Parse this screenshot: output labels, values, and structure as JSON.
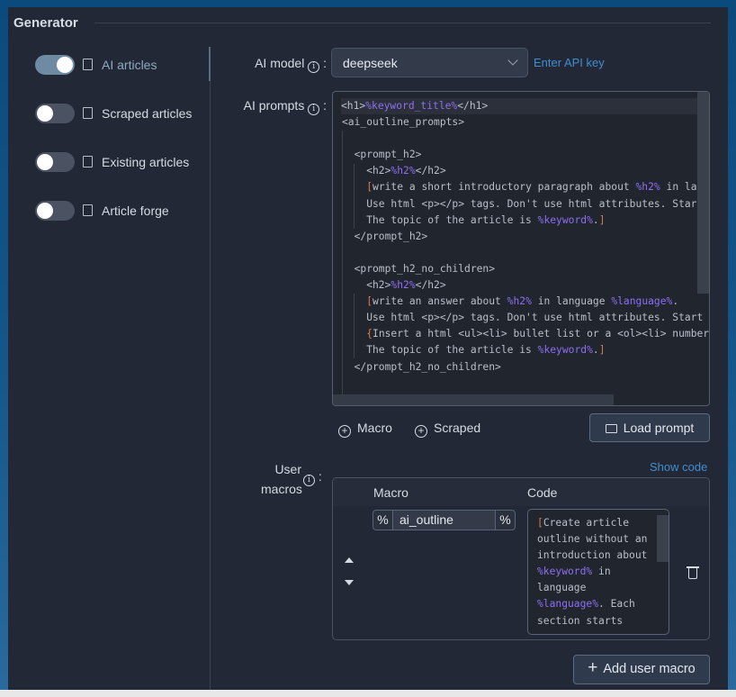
{
  "section_title": "Generator",
  "toggles": [
    {
      "label": "AI articles",
      "on": true,
      "icon": "robot-icon"
    },
    {
      "label": "Scraped articles",
      "on": false,
      "icon": "copy-icon"
    },
    {
      "label": "Existing articles",
      "on": false,
      "icon": "document-icon"
    },
    {
      "label": "Article forge",
      "on": false,
      "icon": "document-icon"
    }
  ],
  "ai_model": {
    "label": "AI model",
    "colon": ":",
    "value": "deepseek",
    "api_link": "Enter API key"
  },
  "ai_prompts": {
    "label": "AI prompts",
    "colon": ":",
    "lines": [
      [
        [
          "t",
          "<h1>"
        ],
        [
          "v",
          "%keyword_title%"
        ],
        [
          "t",
          "</h1>"
        ]
      ],
      [
        [
          "t",
          "<ai_outline_prompts>"
        ]
      ],
      [],
      [
        [
          "t",
          "  <prompt_h2>"
        ]
      ],
      [
        [
          "t",
          "    <h2>"
        ],
        [
          "v",
          "%h2%"
        ],
        [
          "t",
          "</h2>"
        ]
      ],
      [
        [
          "t",
          "    "
        ],
        [
          "b",
          "["
        ],
        [
          "t",
          "write a short introductory paragraph about "
        ],
        [
          "v",
          "%h2%"
        ],
        [
          "t",
          " in langu"
        ]
      ],
      [
        [
          "t",
          "    Use html <p></p> tags. Don't use html attributes. Start w"
        ]
      ],
      [
        [
          "t",
          "    The topic of the article is "
        ],
        [
          "v",
          "%keyword%"
        ],
        [
          "t",
          "."
        ],
        [
          "b",
          "]"
        ]
      ],
      [
        [
          "t",
          "  </prompt_h2>"
        ]
      ],
      [],
      [
        [
          "t",
          "  <prompt_h2_no_children>"
        ]
      ],
      [
        [
          "t",
          "    <h2>"
        ],
        [
          "v",
          "%h2%"
        ],
        [
          "t",
          "</h2>"
        ]
      ],
      [
        [
          "t",
          "    "
        ],
        [
          "b",
          "["
        ],
        [
          "t",
          "write an answer about "
        ],
        [
          "v",
          "%h2%"
        ],
        [
          "t",
          " in language "
        ],
        [
          "v",
          "%language%"
        ],
        [
          "t",
          "."
        ]
      ],
      [
        [
          "t",
          "    Use html <p></p> tags. Don't use html attributes. Start w"
        ]
      ],
      [
        [
          "t",
          "    "
        ],
        [
          "b",
          "{"
        ],
        [
          "t",
          "Insert a html <ul><li> bullet list or a <ol><li> numbere"
        ]
      ],
      [
        [
          "t",
          "    The topic of the article is "
        ],
        [
          "v",
          "%keyword%"
        ],
        [
          "t",
          "."
        ],
        [
          "b",
          "]"
        ]
      ],
      [
        [
          "t",
          "  </prompt_h2_no_children>"
        ]
      ]
    ],
    "macro_btn": "Macro",
    "scraped_btn": "Scraped",
    "load_btn": "Load prompt"
  },
  "user_macros": {
    "label_line1": "User",
    "label_line2": "macros",
    "colon": ":",
    "show_code": "Show code",
    "col_macro": "Macro",
    "col_code": "Code",
    "rows": [
      {
        "prefix": "%",
        "name": "ai_outline",
        "suffix": "%",
        "code_lines": [
          [
            [
              "b",
              "["
            ],
            [
              "t",
              "Create article"
            ]
          ],
          [
            [
              "t",
              "outline without an"
            ]
          ],
          [
            [
              "t",
              "introduction about"
            ]
          ],
          [
            [
              "v",
              "%keyword%"
            ],
            [
              "t",
              " in"
            ]
          ],
          [
            [
              "t",
              "language"
            ]
          ],
          [
            [
              "v",
              "%language%"
            ],
            [
              "t",
              ". Each"
            ]
          ],
          [
            [
              "t",
              "section starts"
            ]
          ]
        ]
      }
    ],
    "add_btn": "Add user macro"
  },
  "colors": {
    "accent_link": "#3f8fce",
    "toggle_on": "#6f8aa3",
    "variable": "#8f6ff0",
    "bracket": "#d9794e"
  }
}
